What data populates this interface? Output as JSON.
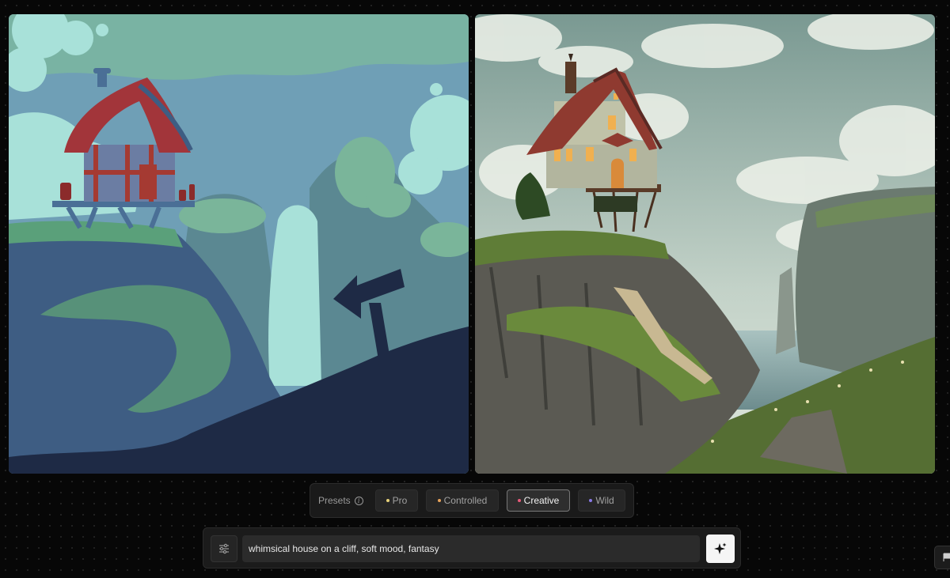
{
  "presets": {
    "label": "Presets",
    "info_icon": "info-icon",
    "items": [
      {
        "label": "Pro",
        "dot_color": "#e8d27a",
        "active": false
      },
      {
        "label": "Controlled",
        "dot_color": "#e8a35a",
        "active": false
      },
      {
        "label": "Creative",
        "dot_color": "#e85a7a",
        "active": true
      },
      {
        "label": "Wild",
        "dot_color": "#8a7ae8",
        "active": false
      }
    ]
  },
  "prompt": {
    "value": "whimsical house on a cliff, soft mood, fantasy",
    "settings_icon": "sliders-icon",
    "generate_icon": "sparkle-icon"
  },
  "side_tab": {
    "icon": "flag-icon"
  },
  "colors": {
    "background": "#070707",
    "panel": "#1b1b1b",
    "input": "#2b2b2b",
    "generate_button": "#f5f5f5"
  }
}
